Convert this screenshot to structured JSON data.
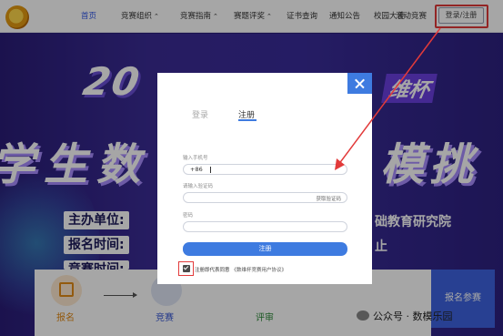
{
  "nav": {
    "items": [
      {
        "label": "首页",
        "active": true,
        "caret": false
      },
      {
        "label": "竞赛组织",
        "active": false,
        "caret": true
      },
      {
        "label": "竞赛指南",
        "active": false,
        "caret": true
      },
      {
        "label": "赛题评奖",
        "active": false,
        "caret": true
      },
      {
        "label": "证书查询",
        "active": false,
        "caret": false
      },
      {
        "label": "通知公告",
        "active": false,
        "caret": false
      },
      {
        "label": "校园大使",
        "active": false,
        "caret": false
      },
      {
        "label": "活动竞赛",
        "active": false,
        "caret": false
      }
    ],
    "login_register": "登录/注册",
    "caret_glyph": "⌃"
  },
  "hero": {
    "year": "20",
    "cup": "维杯",
    "title_left": "学生数",
    "title_right": "模挑",
    "label_organizer": "主办单位:",
    "label_register_time": "报名时间:",
    "label_contest_time": "竞赛时间:",
    "right_organizer": "础教育研究院",
    "right_register": "止"
  },
  "steps": {
    "step1": "报名",
    "step2": "竞赛",
    "step3": "评审",
    "side_button": "报名参赛"
  },
  "watermark": "公众号 · 数模乐园",
  "modal": {
    "tab_login": "登录",
    "tab_register": "注册",
    "phone_label": "输入手机号",
    "phone_prefix": "+86",
    "code_label": "请输入验证码",
    "code_button": "获取验证码",
    "password_label": "密码",
    "submit": "注册",
    "agree_text": "注册即代表同意",
    "agree_link": "《数维杯竞赛用户协议》"
  },
  "colors": {
    "accent": "#3e7be0",
    "highlight": "#e23a3a",
    "hero_bg": "#3b2c96"
  }
}
